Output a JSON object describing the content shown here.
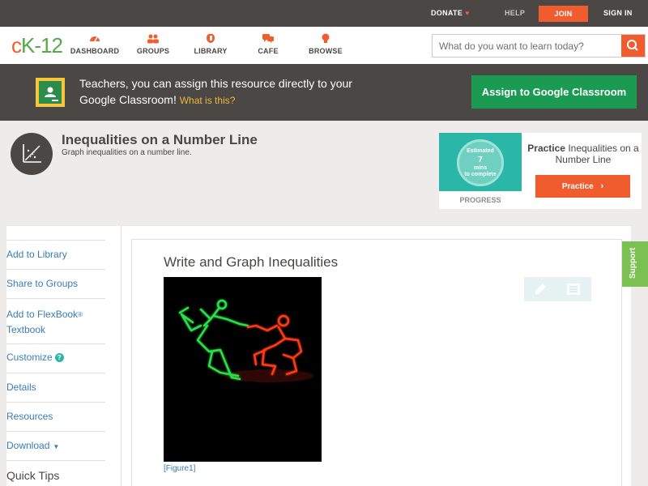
{
  "topbar": {
    "donate": "DONATE",
    "help": "HELP",
    "join": "JOIN",
    "signin": "SIGN IN"
  },
  "nav": {
    "logo": {
      "c": "c",
      "k": "K",
      "dash": "-",
      "num": "12"
    },
    "items": [
      {
        "label": "DASHBOARD",
        "icon": "dashboard-icon"
      },
      {
        "label": "GROUPS",
        "icon": "groups-icon"
      },
      {
        "label": "LIBRARY",
        "icon": "library-icon"
      },
      {
        "label": "CAFE",
        "icon": "cafe-icon"
      },
      {
        "label": "BROWSE",
        "icon": "browse-icon"
      }
    ],
    "search_placeholder": "What do you want to learn today?"
  },
  "classroom_banner": {
    "text": "Teachers, you can assign this resource directly to your Google Classroom!",
    "what_is_this": "What is this?",
    "button": "Assign to Google Classroom"
  },
  "concept": {
    "title": "Inequalities on a Number Line",
    "subtitle": "Graph inequalities on a number line."
  },
  "practice_card": {
    "estimated": "Estimated",
    "minutes": "7",
    "mins_label": "mins",
    "to_complete": "to complete",
    "progress": "PROGRESS",
    "title_bold": "Practice",
    "title_rest": " Inequalities on a Number Line",
    "button": "Practice"
  },
  "sidebar": {
    "items": [
      "Add to Library",
      "Share to Groups",
      "Add to FlexBook",
      "Customize",
      "Details",
      "Resources",
      "Download",
      "Quick Tips"
    ],
    "flexbook_reg": "®",
    "flexbook_line2": "Textbook",
    "customize_help": "?",
    "download_caret": "▼"
  },
  "content": {
    "title": "Write and Graph Inequalities",
    "figure_caption": "[Figure1]"
  },
  "support_tab": "Support",
  "colors": {
    "brand_orange": "#f15c2f",
    "brand_green": "#56a945",
    "classroom_green": "#1b9b52",
    "link_blue": "#3a7bb5",
    "dark_bar": "#4a4745"
  }
}
